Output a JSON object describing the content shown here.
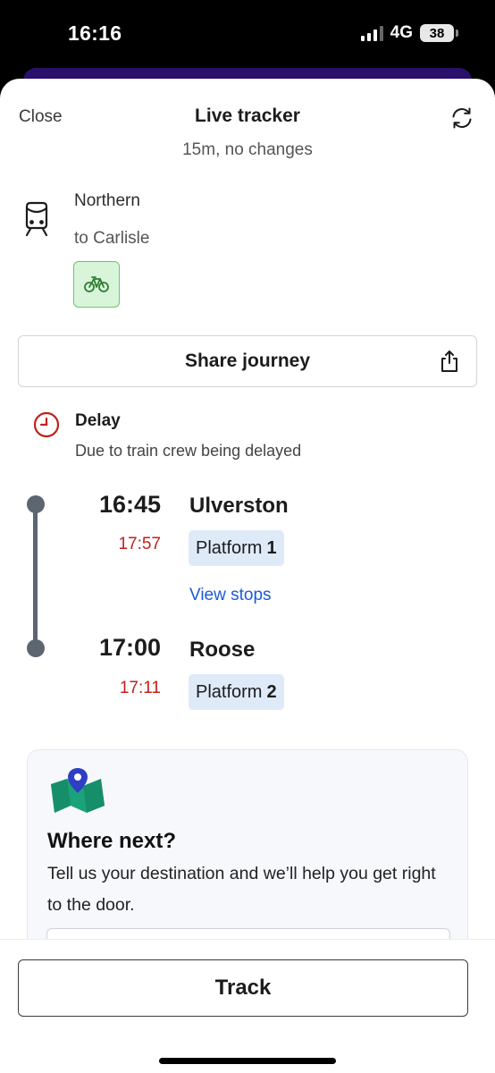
{
  "status_bar": {
    "time": "16:16",
    "network": "4G",
    "battery": "38"
  },
  "header": {
    "close_label": "Close",
    "title": "Live tracker",
    "subtitle": "15m, no changes"
  },
  "service": {
    "operator": "Northern",
    "destination": "to Carlisle",
    "bike_icon": "bicycle-icon",
    "accent": "#6cc46c"
  },
  "share": {
    "label": "Share journey"
  },
  "delay": {
    "title": "Delay",
    "reason": "Due to train crew being delayed",
    "color": "#c0221d"
  },
  "stops": [
    {
      "scheduled": "16:45",
      "expected": "17:57",
      "name": "Ulverston",
      "platform_label": "Platform",
      "platform_number": "1"
    },
    {
      "scheduled": "17:00",
      "expected": "17:11",
      "name": "Roose",
      "platform_label": "Platform",
      "platform_number": "2"
    }
  ],
  "view_stops_label": "View stops",
  "where_next": {
    "title": "Where next?",
    "text": "Tell us your destination and we’ll help you get right to the door."
  },
  "track_button_label": "Track"
}
